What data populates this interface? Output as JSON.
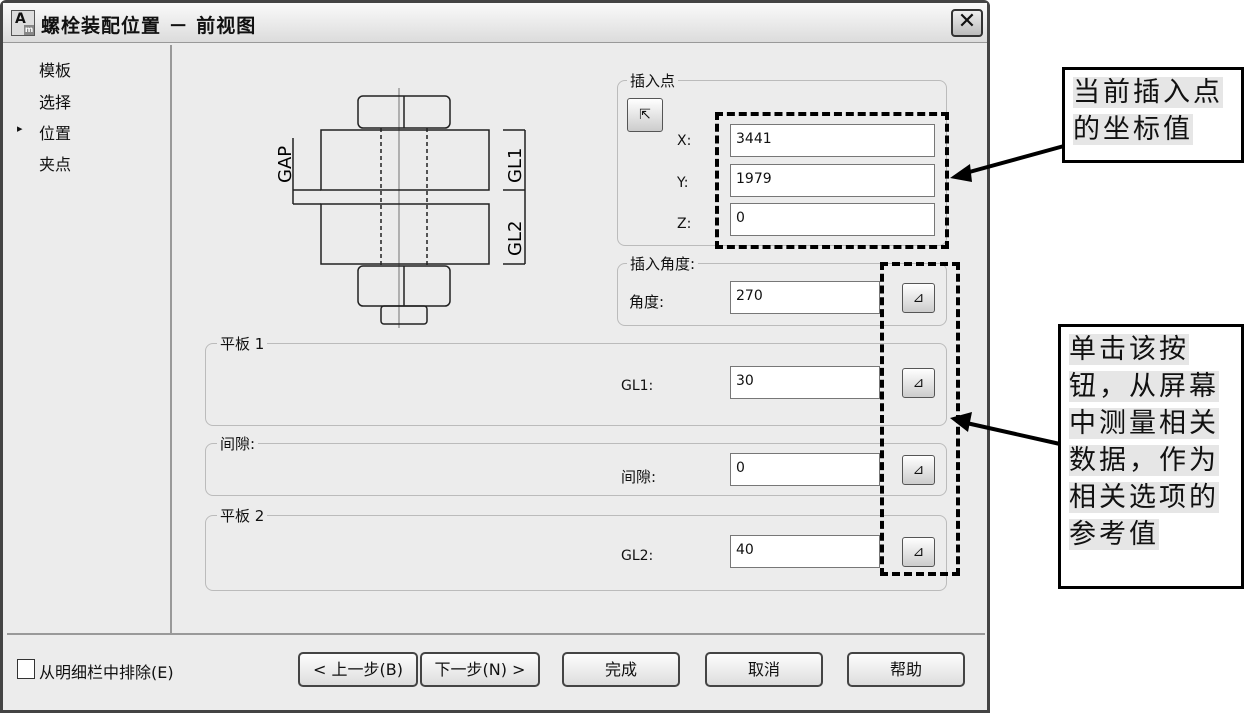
{
  "window": {
    "title": "螺栓装配位置 － 前视图",
    "icon": "autocad-mechanical-icon",
    "icon_letter": "A",
    "icon_sub": "m",
    "close": "✕"
  },
  "nav": {
    "items": [
      {
        "label": "模板"
      },
      {
        "label": "选择"
      },
      {
        "label": "位置",
        "active": true
      },
      {
        "label": "夹点"
      }
    ],
    "active_marker": "▸"
  },
  "drawing": {
    "labels": [
      "GAP",
      "GL1",
      "GL2"
    ]
  },
  "insert_point": {
    "group": "插入点",
    "x_label": "X:",
    "x": "3441",
    "y_label": "Y:",
    "y": "1979",
    "z_label": "Z:",
    "z": "0"
  },
  "insert_angle": {
    "group": "插入角度:",
    "label": "角度:",
    "value": "270"
  },
  "plate1": {
    "group": "平板 1",
    "label": "GL1:",
    "value": "30"
  },
  "gap": {
    "group": "间隙:",
    "label": "间隙:",
    "value": "0"
  },
  "plate2": {
    "group": "平板 2",
    "label": "GL2:",
    "value": "40"
  },
  "footer": {
    "exclude": "从明细栏中排除(E)",
    "prev": "< 上一步(B)",
    "next": "下一步(N) >",
    "finish": "完成",
    "cancel": "取消",
    "help": "帮助"
  },
  "annotations": {
    "top": "当前插入点的坐标值",
    "right": "单击该按钮，从屏幕中测量相关数据，作为相关选项的参考值"
  }
}
